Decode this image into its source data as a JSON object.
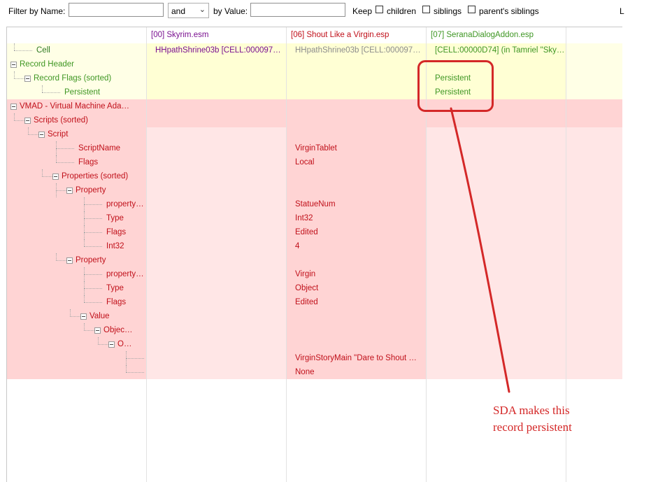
{
  "filter": {
    "name_label": "Filter by Name:",
    "name_value": "",
    "operator": "and",
    "value_label": "by Value:",
    "value_value": "",
    "keep_label": "Keep",
    "children_label": "children",
    "siblings_label": "siblings",
    "parents_siblings_label": "parent's siblings",
    "cut_label": "L"
  },
  "columns": [
    {
      "label": "",
      "color": "#000000"
    },
    {
      "label": "[00] Skyrim.esm",
      "color": "#7a1090"
    },
    {
      "label": "[06] Shout Like a Virgin.esp",
      "color": "#c0101a"
    },
    {
      "label": "[07] SeranaDialogAddon.esp",
      "color": "#3e9623"
    },
    {
      "label": "",
      "color": "#000000"
    }
  ],
  "rows": [
    {
      "level": 1,
      "toggle": false,
      "name": "Cell",
      "values": [
        "HHpathShrine03b [CELL:000097…",
        "HHpathShrine03b [CELL:000097…",
        "[CELL:00000D74] (in Tamriel \"Sky…"
      ],
      "group": "cell"
    },
    {
      "level": 0,
      "toggle": true,
      "name": "Record Header",
      "values": [
        "",
        "",
        ""
      ],
      "group": "header"
    },
    {
      "level": 1,
      "toggle": true,
      "name": "Record Flags (sorted)",
      "values": [
        "",
        "",
        "Persistent"
      ],
      "group": "header"
    },
    {
      "level": 3,
      "toggle": false,
      "name": "Persistent",
      "values": [
        "",
        "",
        "Persistent"
      ],
      "group": "header"
    },
    {
      "level": 0,
      "toggle": true,
      "name": "VMAD - Virtual Machine Ada…",
      "values": [
        "",
        "",
        ""
      ],
      "group": "vmad"
    },
    {
      "level": 1,
      "toggle": true,
      "name": "Scripts (sorted)",
      "values": [
        "",
        "",
        ""
      ],
      "group": "vmad"
    },
    {
      "level": 2,
      "toggle": true,
      "name": "Script",
      "values": [
        "",
        "",
        ""
      ],
      "group": "vmad-light"
    },
    {
      "level": 4,
      "toggle": false,
      "name": "ScriptName",
      "values": [
        "",
        "VirginTablet",
        ""
      ],
      "group": "vmad-light"
    },
    {
      "level": 4,
      "toggle": false,
      "name": "Flags",
      "values": [
        "",
        "Local",
        ""
      ],
      "group": "vmad-light"
    },
    {
      "level": 3,
      "toggle": true,
      "name": "Properties (sorted)",
      "values": [
        "",
        "",
        ""
      ],
      "group": "vmad-light"
    },
    {
      "level": 4,
      "toggle": true,
      "name": "Property",
      "values": [
        "",
        "",
        ""
      ],
      "group": "vmad-light"
    },
    {
      "level": 6,
      "toggle": false,
      "name": "property…",
      "values": [
        "",
        "StatueNum",
        ""
      ],
      "group": "vmad-light"
    },
    {
      "level": 6,
      "toggle": false,
      "name": "Type",
      "values": [
        "",
        "Int32",
        ""
      ],
      "group": "vmad-light"
    },
    {
      "level": 6,
      "toggle": false,
      "name": "Flags",
      "values": [
        "",
        "Edited",
        ""
      ],
      "group": "vmad-light"
    },
    {
      "level": 6,
      "toggle": false,
      "name": "Int32",
      "values": [
        "",
        "4",
        ""
      ],
      "group": "vmad-light"
    },
    {
      "level": 4,
      "toggle": true,
      "name": "Property",
      "values": [
        "",
        "",
        ""
      ],
      "group": "vmad-light"
    },
    {
      "level": 6,
      "toggle": false,
      "name": "property…",
      "values": [
        "",
        "Virgin",
        ""
      ],
      "group": "vmad-light"
    },
    {
      "level": 6,
      "toggle": false,
      "name": "Type",
      "values": [
        "",
        "Object",
        ""
      ],
      "group": "vmad-light"
    },
    {
      "level": 6,
      "toggle": false,
      "name": "Flags",
      "values": [
        "",
        "Edited",
        ""
      ],
      "group": "vmad-light"
    },
    {
      "level": 5,
      "toggle": true,
      "name": "Value",
      "values": [
        "",
        "",
        ""
      ],
      "group": "vmad-light"
    },
    {
      "level": 6,
      "toggle": true,
      "name": "Objec…",
      "values": [
        "",
        "",
        ""
      ],
      "group": "vmad-light"
    },
    {
      "level": 7,
      "toggle": true,
      "name": "O…",
      "values": [
        "",
        "",
        ""
      ],
      "group": "vmad-light"
    },
    {
      "level": 9,
      "toggle": false,
      "name": "",
      "values": [
        "",
        "VirginStoryMain \"Dare to Shout …",
        ""
      ],
      "group": "vmad-light"
    },
    {
      "level": 9,
      "toggle": false,
      "name": "",
      "values": [
        "",
        "None",
        ""
      ],
      "group": "vmad-light"
    }
  ],
  "palette": {
    "cell": {
      "name": "#2f7a22",
      "vals": [
        "#7a1090",
        "#8c8c8c",
        "#3e9623"
      ],
      "bg": [
        "#ffffe6",
        "#ffffd4",
        "#ffffd4",
        "#ffffd4",
        "#ffffe6"
      ]
    },
    "header": {
      "name": "#3e9623",
      "vals": [
        "#000000",
        "#000000",
        "#3e9623"
      ],
      "bg": [
        "#ffffe6",
        "#ffffd4",
        "#ffffd4",
        "#ffffd4",
        "#ffffe6"
      ]
    },
    "vmad": {
      "name": "#c0101a",
      "vals": [
        "#000000",
        "#c0101a",
        "#c0101a"
      ],
      "bg": [
        "#ffd4d4",
        "#ffd4d4",
        "#ffd4d4",
        "#ffd4d4",
        "#ffd4d4"
      ]
    },
    "vmad-light": {
      "name": "#c0101a",
      "vals": [
        "#000000",
        "#c0101a",
        "#c0101a"
      ],
      "bg": [
        "#ffd4d4",
        "#ffe6e6",
        "#ffd4d4",
        "#ffe6e6",
        "#ffe6e6"
      ]
    }
  },
  "annotation": {
    "lines": [
      "SDA makes this",
      "record persistent"
    ],
    "color": "#d42828"
  }
}
